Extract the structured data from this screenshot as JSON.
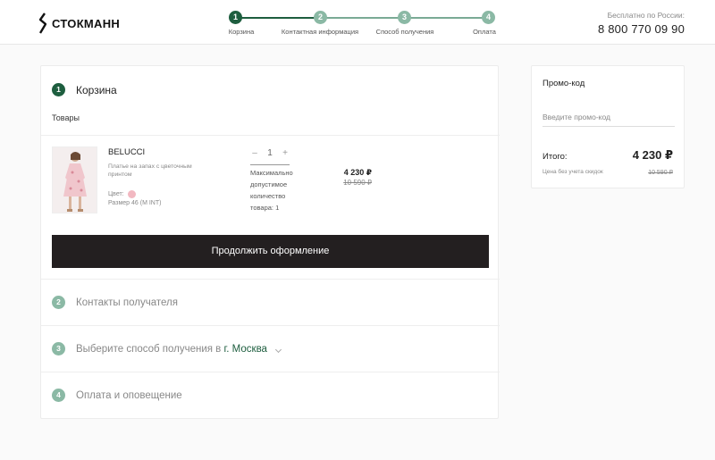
{
  "header": {
    "logo_text": "СТОКМАНН",
    "phone_caption": "Бесплатно по России:",
    "phone_number": "8 800 770 09 90"
  },
  "stepper": {
    "steps": [
      {
        "number": "1",
        "label": "Корзина",
        "active": true
      },
      {
        "number": "2",
        "label": "Контактная информация",
        "active": false
      },
      {
        "number": "3",
        "label": "Способ получения",
        "active": false
      },
      {
        "number": "4",
        "label": "Оплата",
        "active": false
      }
    ]
  },
  "cart": {
    "step_number": "1",
    "title": "Корзина",
    "goods_label": "Товары",
    "item": {
      "image_icon": "dress-photo",
      "brand": "BELUCCI",
      "description": "Платье на запах с цветочным принтом",
      "color_label": "Цвет:",
      "color_value": "#f2b8c1",
      "size_label": "Размер 46 (M INT)",
      "qty_minus": "–",
      "qty_value": "1",
      "qty_plus": "+",
      "max_qty_text": "Максимально допустимое количество товара: 1",
      "price": "4 230 ₽",
      "old_price": "10 590 ₽"
    },
    "continue_button": "Продолжить оформление"
  },
  "sections": [
    {
      "number": "2",
      "label": "Контакты получателя"
    },
    {
      "number": "3",
      "label": "Выберите способ получения в",
      "city": "г. Москва"
    },
    {
      "number": "4",
      "label": "Оплата и оповещение"
    }
  ],
  "promo": {
    "title": "Промо-код",
    "placeholder": "Введите промо-код",
    "total_label": "Итого:",
    "total_value": "4 230 ₽",
    "nodisc_label": "Цена без учета скидок",
    "nodisc_value": "10 590 ₽"
  },
  "colors": {
    "accent_green": "#1e5e3f",
    "inactive_green": "#8bb9a5",
    "button_dark": "#231f20"
  }
}
